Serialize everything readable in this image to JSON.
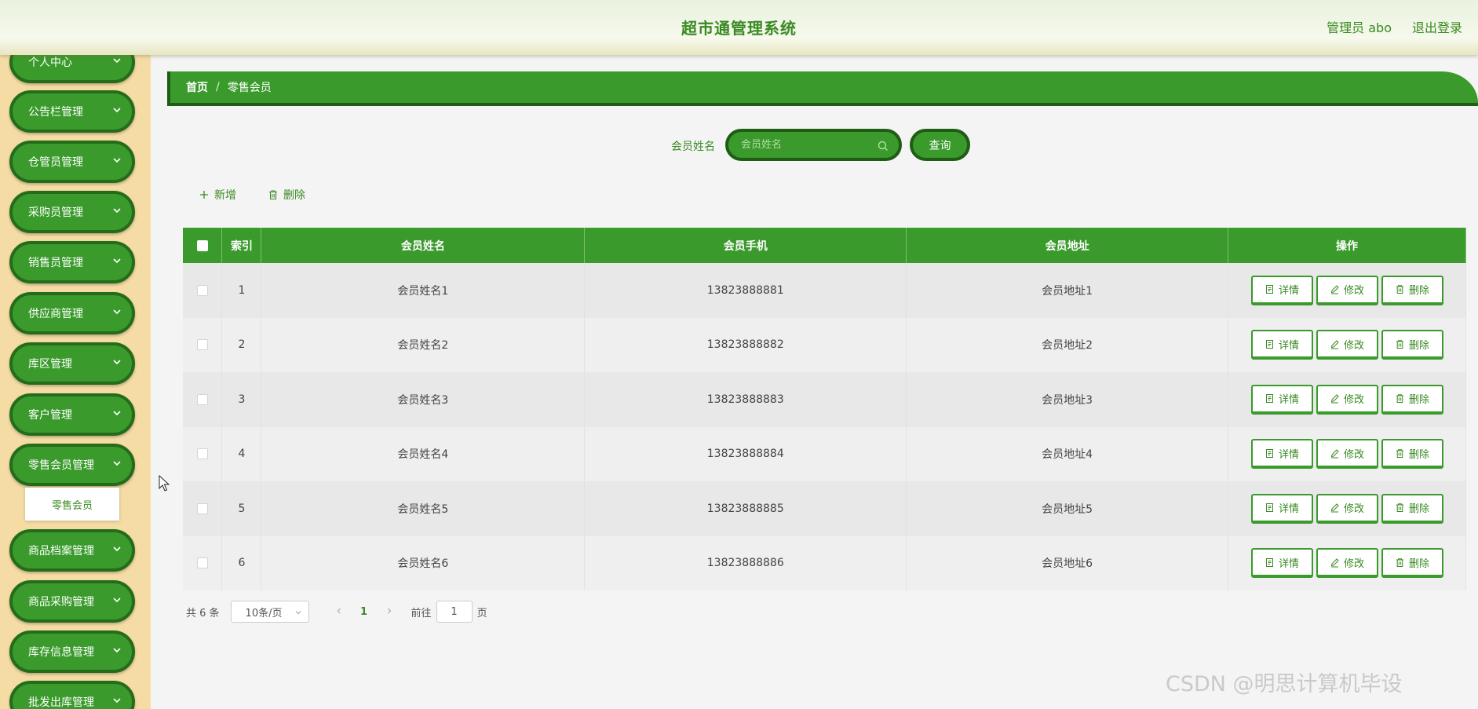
{
  "header": {
    "title": "超市通管理系统",
    "user": "管理员 abo",
    "logout": "退出登录"
  },
  "sidebar": {
    "items": [
      {
        "label": "个人中心"
      },
      {
        "label": "公告栏管理"
      },
      {
        "label": "仓管员管理"
      },
      {
        "label": "采购员管理"
      },
      {
        "label": "销售员管理"
      },
      {
        "label": "供应商管理"
      },
      {
        "label": "库区管理"
      },
      {
        "label": "客户管理"
      },
      {
        "label": "零售会员管理"
      },
      {
        "label": "商品档案管理"
      },
      {
        "label": "商品采购管理"
      },
      {
        "label": "库存信息管理"
      },
      {
        "label": "批发出库管理"
      }
    ],
    "submenu_label": "零售会员"
  },
  "breadcrumb": {
    "home": "首页",
    "separator": "/",
    "current": "零售会员"
  },
  "search": {
    "label": "会员姓名",
    "placeholder": "会员姓名",
    "button": "查询"
  },
  "toolbar": {
    "add": "新增",
    "delete": "删除"
  },
  "table": {
    "headers": {
      "index": "索引",
      "name": "会员姓名",
      "phone": "会员手机",
      "address": "会员地址",
      "actions": "操作"
    },
    "rows": [
      {
        "index": "1",
        "name": "会员姓名1",
        "phone": "13823888881",
        "address": "会员地址1"
      },
      {
        "index": "2",
        "name": "会员姓名2",
        "phone": "13823888882",
        "address": "会员地址2"
      },
      {
        "index": "3",
        "name": "会员姓名3",
        "phone": "13823888883",
        "address": "会员地址3"
      },
      {
        "index": "4",
        "name": "会员姓名4",
        "phone": "13823888884",
        "address": "会员地址4"
      },
      {
        "index": "5",
        "name": "会员姓名5",
        "phone": "13823888885",
        "address": "会员地址5"
      },
      {
        "index": "6",
        "name": "会员姓名6",
        "phone": "13823888886",
        "address": "会员地址6"
      }
    ],
    "action_labels": {
      "detail": "详情",
      "edit": "修改",
      "delete": "删除"
    }
  },
  "pagination": {
    "total": "共 6 条",
    "page_size": "10条/页",
    "current_page": "1",
    "goto_label": "前往",
    "goto_value": "1",
    "page_suffix": "页"
  },
  "watermark": "CSDN @明思计算机毕设",
  "colors": {
    "primary": "#3a9a2c",
    "primary_dark": "#1f5c14",
    "sidebar_bg": "#f5dca4",
    "header_text": "#3a8a22"
  }
}
